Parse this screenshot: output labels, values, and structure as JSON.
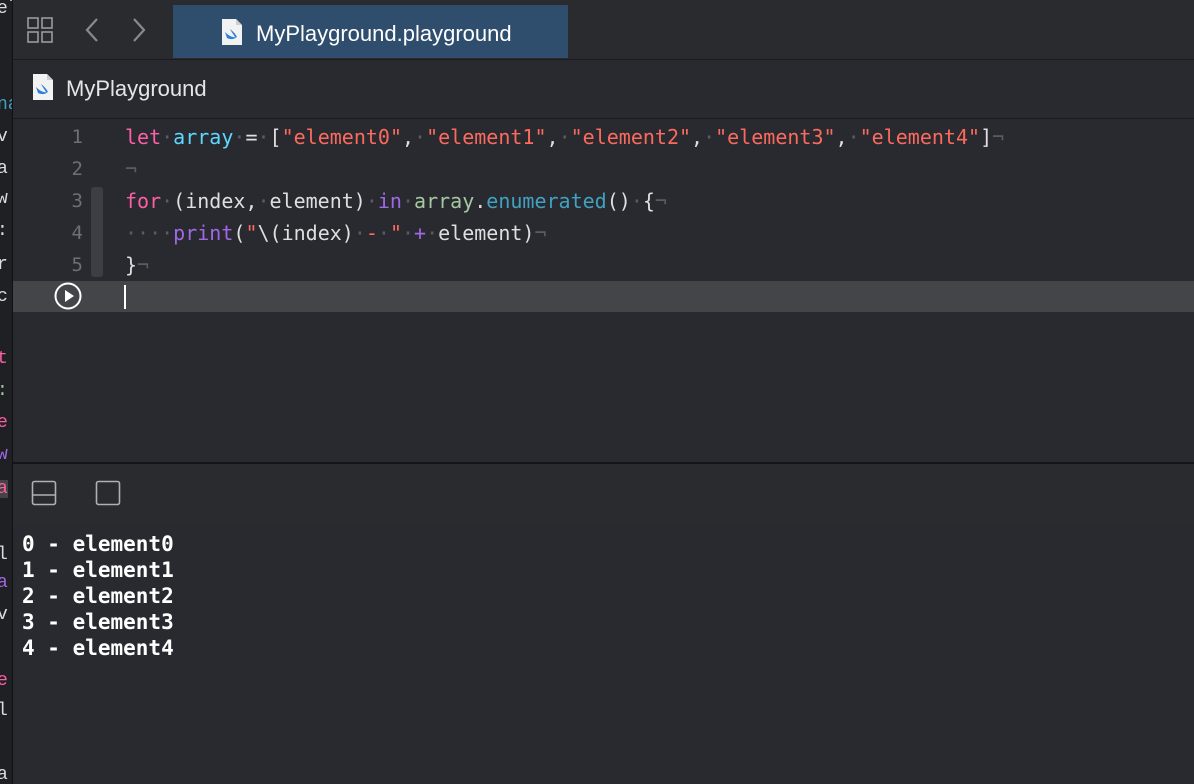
{
  "tab": {
    "title": "MyPlayground.playground"
  },
  "breadcrumb": {
    "label": "MyPlayground"
  },
  "icons": {
    "grid": "grid-icon",
    "back": "chevron-left-icon",
    "forward": "chevron-right-icon",
    "file": "swift-file-icon",
    "run": "play-icon",
    "hide_debug": "hide-debug-area-icon",
    "toggle_console": "console-icon"
  },
  "editor": {
    "line_numbers": [
      "1",
      "2",
      "3",
      "4",
      "5"
    ],
    "lines": [
      "let array = [\"element0\", \"element1\", \"element2\", \"element3\", \"element4\"]",
      "",
      "for (index, element) in array.enumerated() {",
      "    print(\"\\(index) - \" + element)",
      "}"
    ]
  },
  "console": {
    "output": [
      "0 - element0",
      "1 - element1",
      "2 - element2",
      "3 - element3",
      "4 - element4"
    ]
  },
  "colors": {
    "keyword": "#fc5fa3",
    "string": "#fc6a5d",
    "background": "#292a30",
    "tab_active": "#2f4e6e"
  }
}
